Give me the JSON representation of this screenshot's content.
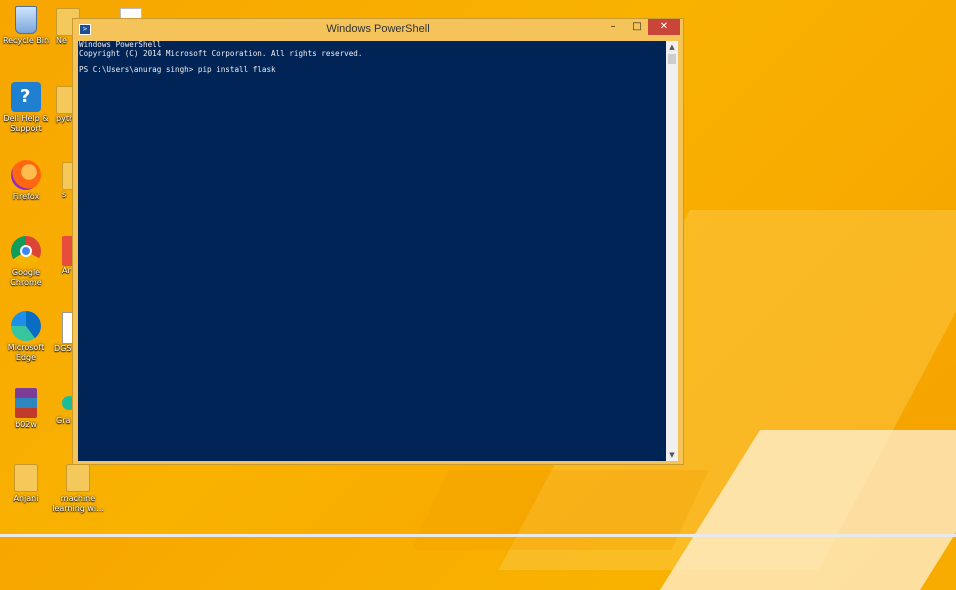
{
  "desktop": {
    "icons_col1": [
      {
        "label": "Recycle Bin",
        "icon": "recycle-bin-icon"
      },
      {
        "label": "Dell Help & Support",
        "icon": "help-icon"
      },
      {
        "label": "Firefox",
        "icon": "firefox-icon"
      },
      {
        "label": "Google Chrome",
        "icon": "chrome-icon"
      },
      {
        "label": "Microsoft Edge",
        "icon": "edge-icon"
      },
      {
        "label": "b02w",
        "icon": "winrar-icon"
      },
      {
        "label": "Anjani",
        "icon": "folder-icon"
      }
    ],
    "icons_col2": [
      {
        "label": "Ne",
        "icon": "folder-icon"
      },
      {
        "label": "pyth",
        "icon": "folder-icon"
      },
      {
        "label": "s",
        "icon": "folder-icon"
      },
      {
        "label": "Ar",
        "icon": "app-icon"
      },
      {
        "label": "DGS",
        "icon": "app-icon"
      },
      {
        "label": "Gra",
        "icon": "app-icon"
      },
      {
        "label": "machine learning wi...",
        "icon": "folder-icon"
      }
    ]
  },
  "window": {
    "title": "Windows PowerShell",
    "buttons": {
      "minimize": "–",
      "maximize": "□",
      "close": "✕"
    },
    "console_lines": [
      "Windows PowerShell",
      "Copyright (C) 2014 Microsoft Corporation. All rights reserved.",
      "",
      "PS C:\\Users\\anurag singh> pip install flask"
    ],
    "scroll": {
      "up": "▲",
      "down": "▼"
    }
  },
  "colors": {
    "console_bg": "#012456",
    "window_frame": "#f4c45a",
    "close_button": "#c9453a"
  }
}
